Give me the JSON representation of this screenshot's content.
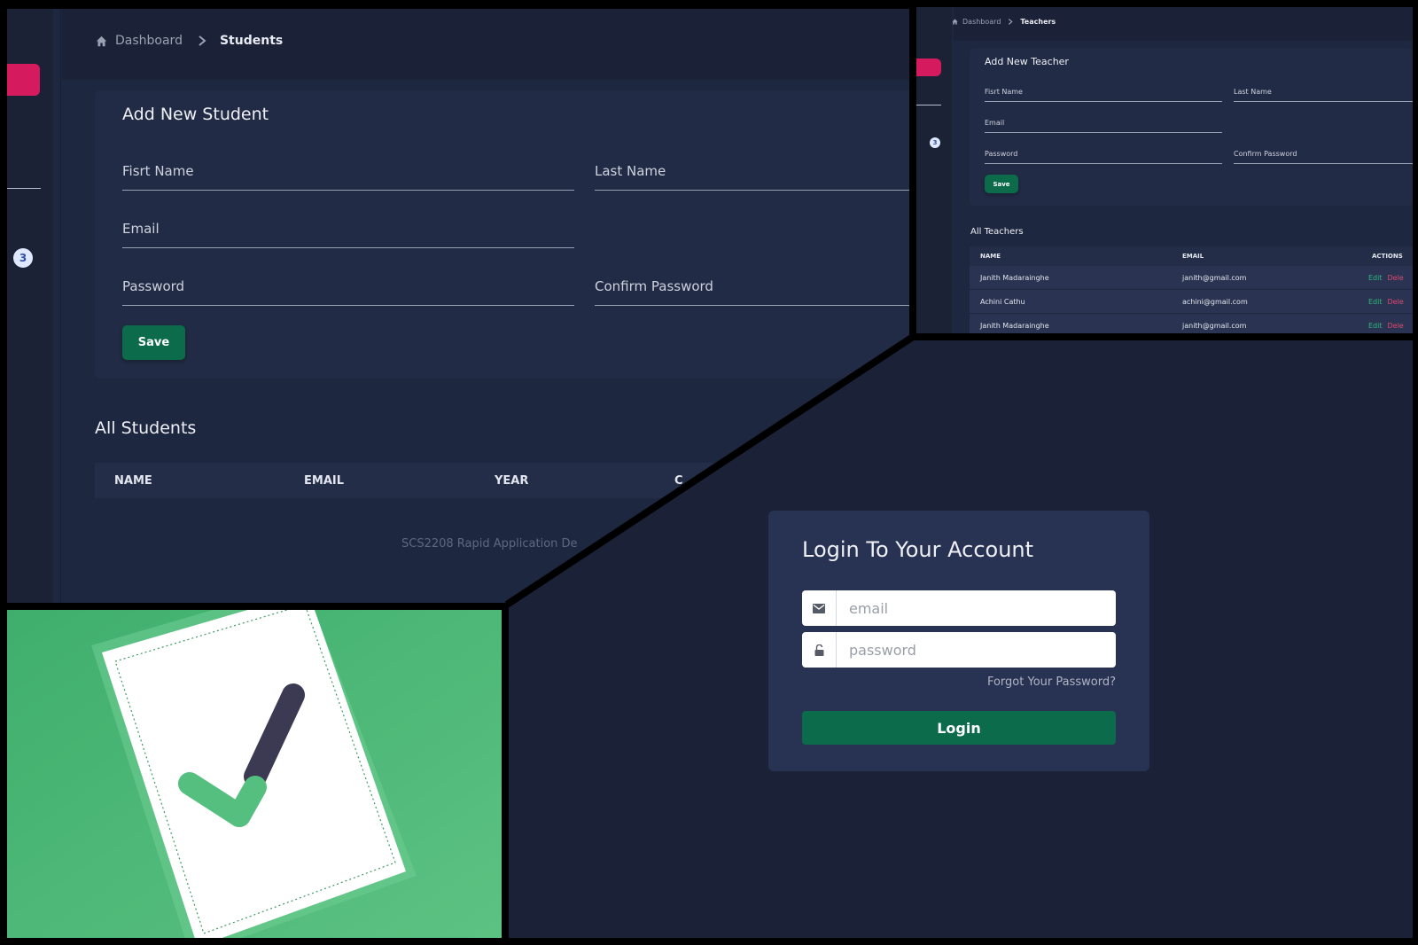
{
  "students": {
    "breadcrumb": {
      "home": "Dashboard",
      "current": "Students"
    },
    "badge": "3",
    "form": {
      "title": "Add New Student",
      "first_name": "Fisrt Name",
      "last_name": "Last Name",
      "email": "Email",
      "password": "Password",
      "confirm_password": "Confirm Password",
      "save": "Save"
    },
    "list_title": "All Students",
    "columns": [
      "NAME",
      "EMAIL",
      "YEAR",
      "C"
    ],
    "footer": "SCS2208 Rapid Application De"
  },
  "teachers": {
    "breadcrumb": {
      "home": "Dashboard",
      "current": "Teachers"
    },
    "badge": "3",
    "form": {
      "title": "Add New Teacher",
      "first_name": "Fisrt Name",
      "last_name": "Last Name",
      "email": "Email",
      "password": "Password",
      "confirm_password": "Confirm Password",
      "save": "Save"
    },
    "list_title": "All Teachers",
    "columns": [
      "NAME",
      "EMAIL",
      "ACTIONS"
    ],
    "rows": [
      {
        "name": "Janith Madarainghe",
        "email": "janith@gmail.com",
        "edit": "Edit",
        "delete": "Dele"
      },
      {
        "name": "Achini Cathu",
        "email": "achini@gmail.com",
        "edit": "Edit",
        "delete": "Dele"
      },
      {
        "name": "Janith Madarainghe",
        "email": "janith@gmail.com",
        "edit": "Edit",
        "delete": "Dele"
      }
    ]
  },
  "login": {
    "title": "Login To Your Account",
    "email_placeholder": "email",
    "password_placeholder": "password",
    "forgot": "Forgot Your Password?",
    "button": "Login"
  },
  "colors": {
    "background": "#1b2237",
    "card": "#222b45",
    "accent_pink": "#d61a5e",
    "primary_green": "#0c6b4a",
    "illustration_green": "#4fb879"
  }
}
